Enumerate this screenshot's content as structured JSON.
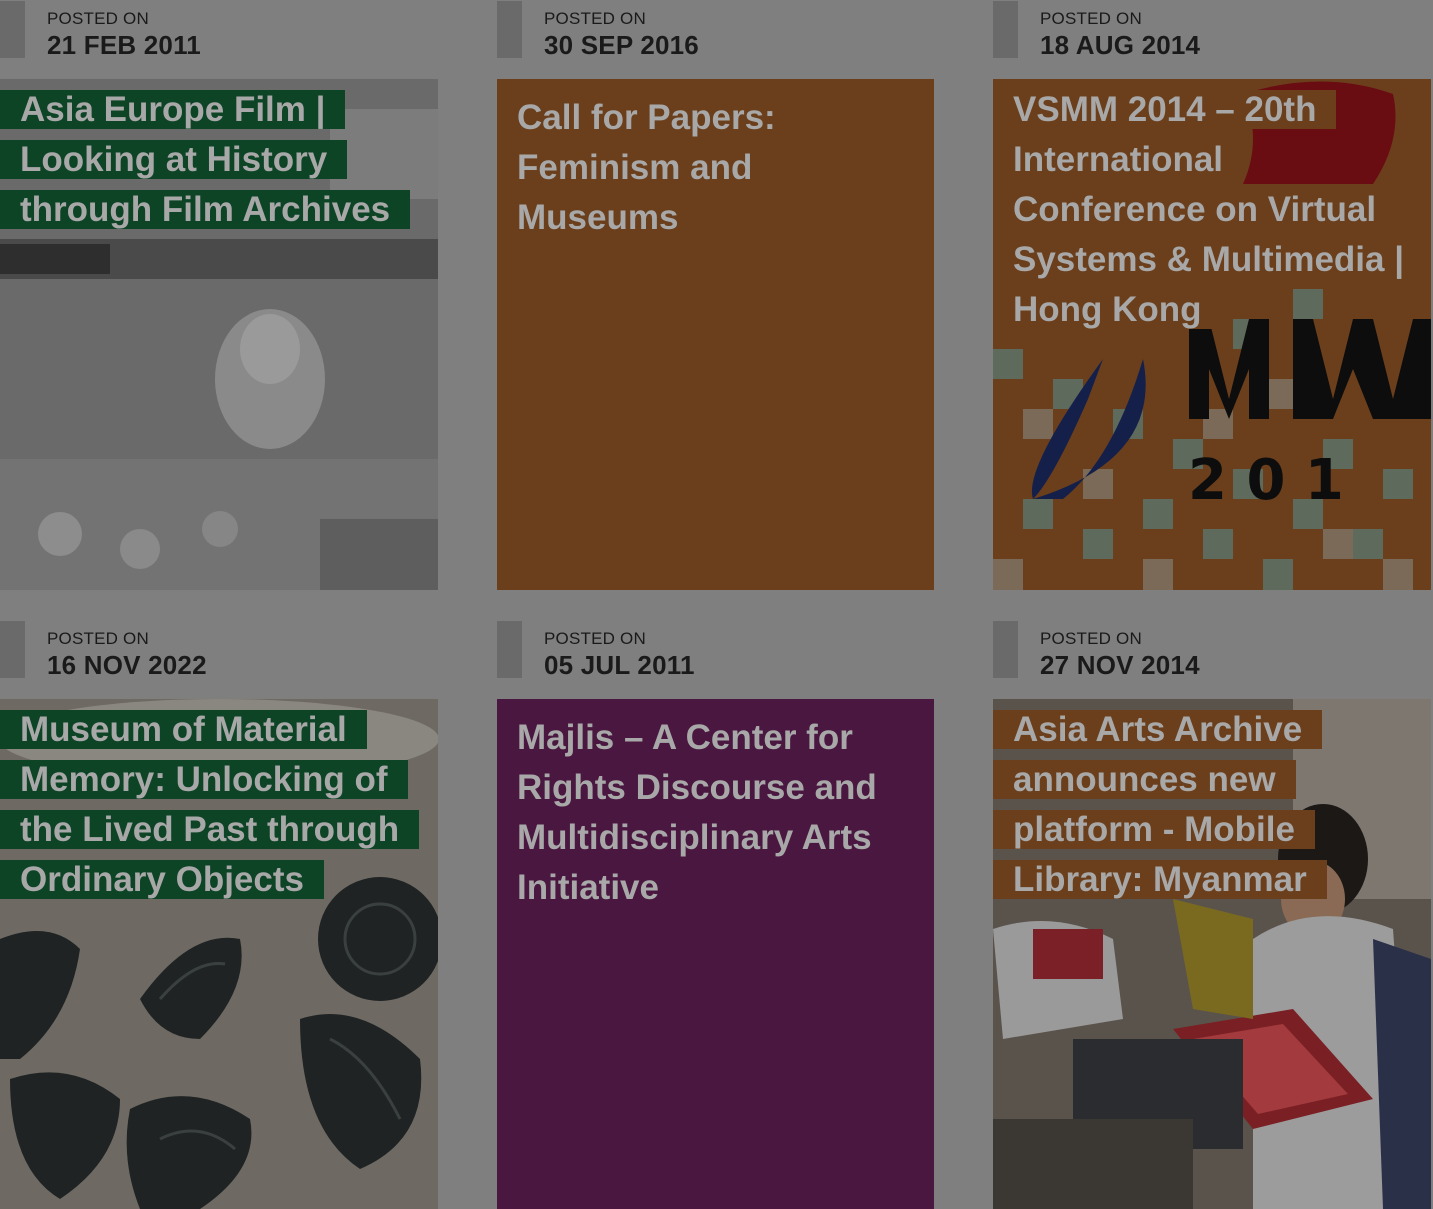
{
  "posts": [
    {
      "posted_label": "POSTED ON",
      "date": "21 FEB 2011",
      "title": "Asia Europe Film | Looking at History through Film Archives",
      "title_lines": [
        "Asia Europe Film |",
        "Looking at History",
        "through Film Archives"
      ],
      "tile_color": "#0d4426",
      "image": "newspaper-film-photo"
    },
    {
      "posted_label": "POSTED ON",
      "date": "30 SEP 2016",
      "title": "Call for Papers: Feminism and Museums",
      "title_lines": [
        "Call for Papers:",
        "Feminism and",
        "Museums"
      ],
      "tile_color": "#6b3f1c",
      "image": null
    },
    {
      "posted_label": "POSTED ON",
      "date": "18 AUG 2014",
      "title": "VSMM 2014 – 20th International Conference on Virtual Systems & Multimedia | Hong Kong",
      "title_lines": [
        "VSMM 2014 – 20th",
        "International",
        "Conference on Virtual",
        "Systems & Multimedia |",
        "Hong Kong"
      ],
      "tile_color": "#6b3f1c",
      "image": "vsmm-2014-logo",
      "image_text": "2 0 1"
    },
    {
      "posted_label": "POSTED ON",
      "date": "16 NOV 2022",
      "title": "Museum of Material Memory: Unlocking of the Lived Past through Ordinary Objects",
      "title_lines": [
        "Museum of Material",
        "Memory: Unlocking of",
        "the Lived Past through",
        "Ordinary Objects"
      ],
      "tile_color": "#0d4426",
      "image": "carved-wooden-blocks-photo"
    },
    {
      "posted_label": "POSTED ON",
      "date": "05 JUL 2011",
      "title": "Majlis – A Center for Rights Discourse and Multidisciplinary Arts Initiative",
      "title_lines": [
        "Majlis – A Center for",
        "Rights Discourse and",
        "Multidisciplinary Arts",
        "Initiative"
      ],
      "tile_color": "#4a1741",
      "image": null
    },
    {
      "posted_label": "POSTED ON",
      "date": "27 NOV 2014",
      "title": "Asia Arts Archive announces new platform - Mobile Library: Myanmar",
      "title_lines": [
        "Asia Arts Archive",
        "announces new",
        "platform - Mobile",
        "Library: Myanmar"
      ],
      "tile_color": "#6b3f1c",
      "image": "students-reading-books-photo"
    }
  ]
}
